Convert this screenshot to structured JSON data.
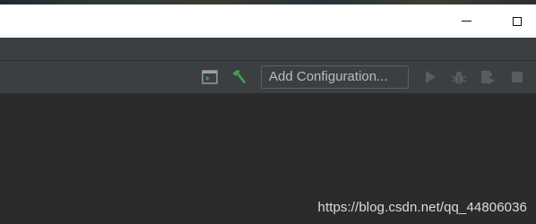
{
  "window": {
    "title": "",
    "controls": {
      "minimize_icon": "minimize-icon",
      "maximize_icon": "maximize-icon"
    }
  },
  "toolbar": {
    "run_anything_icon": "run-anything-icon",
    "build_icon": "hammer-icon",
    "configuration_label": "Add Configuration...",
    "run_icon": "play-icon",
    "debug_icon": "bug-icon",
    "coverage_icon": "run-with-coverage-icon",
    "stop_icon": "stop-icon"
  },
  "watermark": {
    "text": "https://blog.csdn.net/qq_44806036"
  },
  "colors": {
    "titlebar": "#ffffff",
    "toolbar": "#3c3f41",
    "editor": "#2b2b2b",
    "accent_green": "#499c54",
    "disabled_icon": "#5a5d5f"
  }
}
